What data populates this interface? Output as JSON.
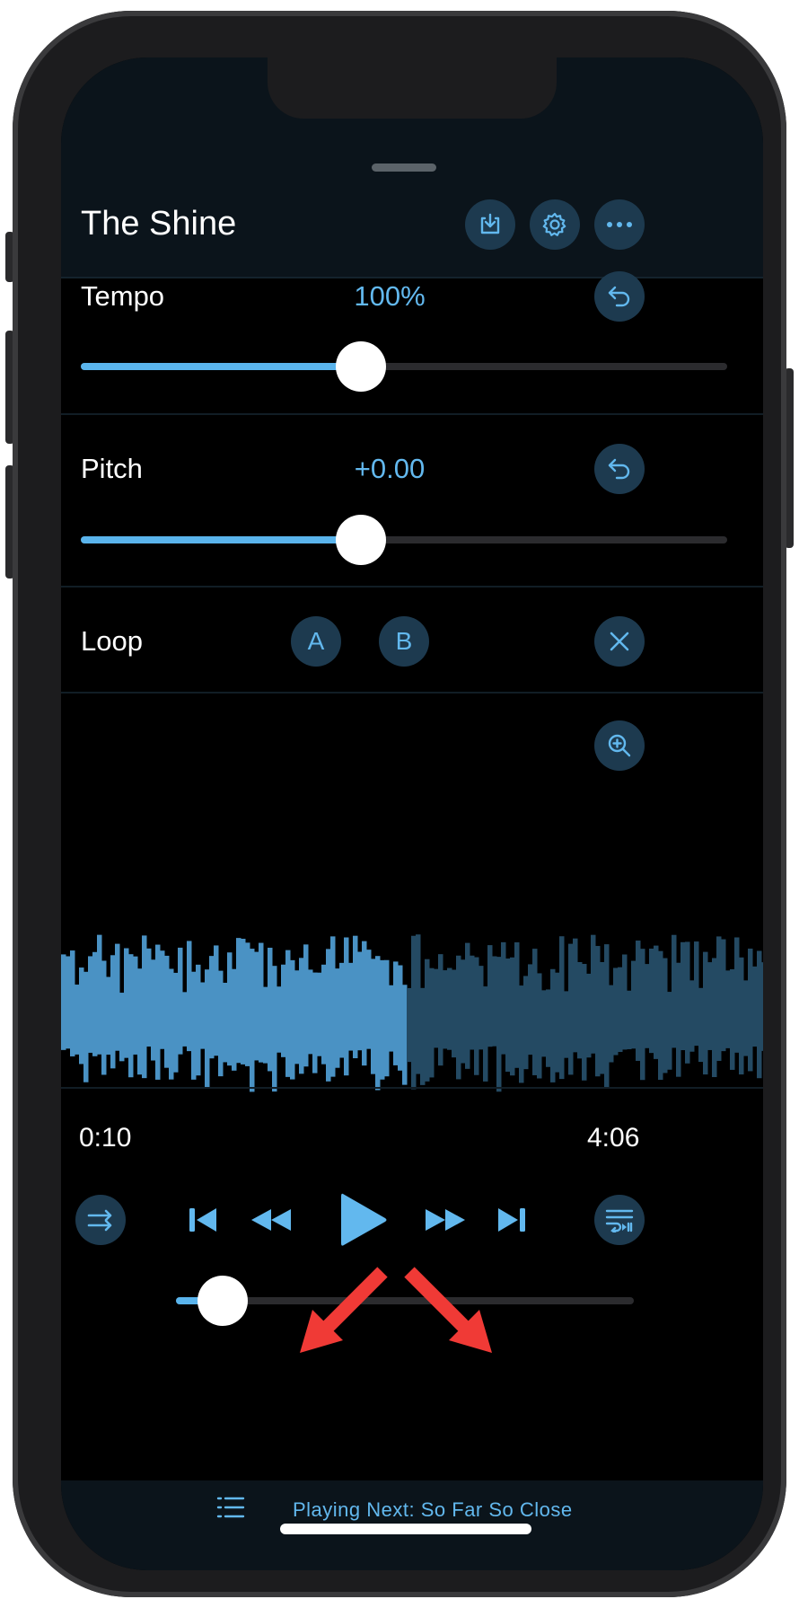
{
  "header": {
    "title": "The Shine",
    "buttons": [
      "download-icon",
      "gear-icon",
      "more-icon"
    ]
  },
  "tempo": {
    "label": "Tempo",
    "value": "100%",
    "slider_fraction": 0.5
  },
  "pitch": {
    "label": "Pitch",
    "value": "+0.00",
    "slider_fraction": 0.5
  },
  "loop": {
    "label": "Loop",
    "a_label": "A",
    "b_label": "B"
  },
  "waveform": {
    "played_fraction": 0.49
  },
  "playback": {
    "elapsed": "0:10",
    "total": "4:06",
    "progress_fraction": 0.07
  },
  "controls": [
    "shuffle-icon",
    "skip-back-icon",
    "rewind-icon",
    "play-icon",
    "fast-forward-icon",
    "skip-forward-icon",
    "queue-icon"
  ],
  "footer": {
    "next_text": "Playing Next: So Far So Close"
  },
  "colors": {
    "accent": "#62b8ee",
    "button_bg": "#1d3a4f",
    "annotation_arrow": "#f03a36"
  }
}
